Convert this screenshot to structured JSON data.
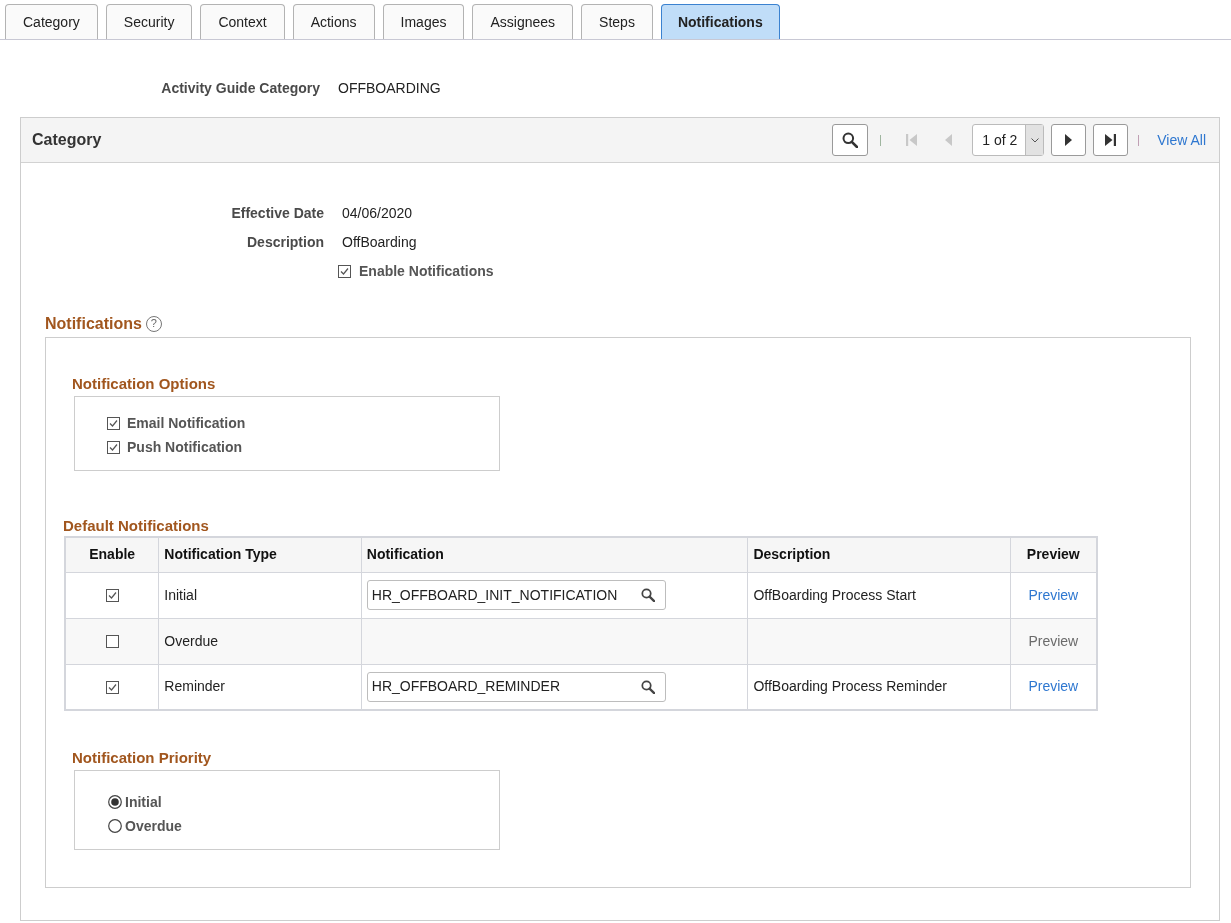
{
  "tabs": [
    {
      "label": "Category",
      "selected": false
    },
    {
      "label": "Security",
      "selected": false
    },
    {
      "label": "Context",
      "selected": false
    },
    {
      "label": "Actions",
      "selected": false
    },
    {
      "label": "Images",
      "selected": false
    },
    {
      "label": "Assignees",
      "selected": false
    },
    {
      "label": "Steps",
      "selected": false
    },
    {
      "label": "Notifications",
      "selected": true
    }
  ],
  "header": {
    "label": "Activity Guide Category",
    "value": "OFFBOARDING"
  },
  "category_panel": {
    "title": "Category",
    "pager": {
      "controls": [
        {
          "kind": "search",
          "disabled": false
        },
        {
          "kind": "separator"
        },
        {
          "kind": "first",
          "disabled": true
        },
        {
          "kind": "previous",
          "disabled": true
        },
        {
          "kind": "page_select",
          "text": "1 of 2"
        },
        {
          "kind": "next",
          "disabled": false
        },
        {
          "kind": "last",
          "disabled": false
        },
        {
          "kind": "separator"
        },
        {
          "kind": "view_all",
          "text": "View All"
        }
      ]
    },
    "fields": [
      {
        "label": "Effective Date",
        "value": "04/06/2020"
      },
      {
        "label": "Description",
        "value": "OffBoarding"
      }
    ],
    "enable_notifications": {
      "label": "Enable Notifications",
      "checked": true
    },
    "notifications": {
      "title": "Notifications",
      "help_icon": "?",
      "options": {
        "title": "Notification Options",
        "items": [
          {
            "label": "Email Notification",
            "checked": true
          },
          {
            "label": "Push Notification",
            "checked": true
          }
        ]
      },
      "default_notifications": {
        "title": "Default Notifications",
        "columns": [
          "Enable",
          "Notification Type",
          "Notification",
          "Description",
          "Preview"
        ],
        "rows": [
          {
            "enabled": true,
            "type": "Initial",
            "notification": "HR_OFFBOARD_INIT_NOTIFICATION",
            "description": "OffBoarding Process Start",
            "preview": {
              "label": "Preview",
              "disabled": false
            }
          },
          {
            "enabled": false,
            "type": "Overdue",
            "preview": {
              "label": "Preview",
              "disabled": true
            }
          },
          {
            "enabled": true,
            "type": "Reminder",
            "notification": "HR_OFFBOARD_REMINDER",
            "description": "OffBoarding Process Reminder",
            "preview": {
              "label": "Preview",
              "disabled": false
            }
          }
        ]
      },
      "priority": {
        "title": "Notification Priority",
        "options": [
          {
            "label": "Initial",
            "selected": true
          },
          {
            "label": "Overdue",
            "selected": false
          }
        ]
      }
    }
  }
}
